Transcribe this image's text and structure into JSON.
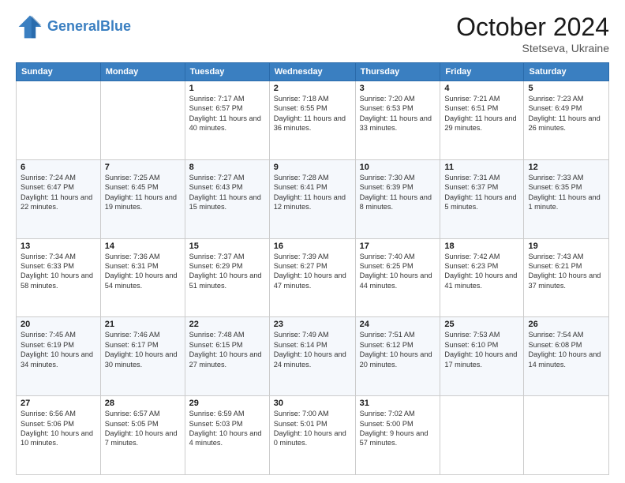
{
  "header": {
    "logo_line1": "General",
    "logo_line2": "Blue",
    "month": "October 2024",
    "location": "Stetseva, Ukraine"
  },
  "weekdays": [
    "Sunday",
    "Monday",
    "Tuesday",
    "Wednesday",
    "Thursday",
    "Friday",
    "Saturday"
  ],
  "weeks": [
    [
      {
        "day": "",
        "info": ""
      },
      {
        "day": "",
        "info": ""
      },
      {
        "day": "1",
        "info": "Sunrise: 7:17 AM\nSunset: 6:57 PM\nDaylight: 11 hours and 40 minutes."
      },
      {
        "day": "2",
        "info": "Sunrise: 7:18 AM\nSunset: 6:55 PM\nDaylight: 11 hours and 36 minutes."
      },
      {
        "day": "3",
        "info": "Sunrise: 7:20 AM\nSunset: 6:53 PM\nDaylight: 11 hours and 33 minutes."
      },
      {
        "day": "4",
        "info": "Sunrise: 7:21 AM\nSunset: 6:51 PM\nDaylight: 11 hours and 29 minutes."
      },
      {
        "day": "5",
        "info": "Sunrise: 7:23 AM\nSunset: 6:49 PM\nDaylight: 11 hours and 26 minutes."
      }
    ],
    [
      {
        "day": "6",
        "info": "Sunrise: 7:24 AM\nSunset: 6:47 PM\nDaylight: 11 hours and 22 minutes."
      },
      {
        "day": "7",
        "info": "Sunrise: 7:25 AM\nSunset: 6:45 PM\nDaylight: 11 hours and 19 minutes."
      },
      {
        "day": "8",
        "info": "Sunrise: 7:27 AM\nSunset: 6:43 PM\nDaylight: 11 hours and 15 minutes."
      },
      {
        "day": "9",
        "info": "Sunrise: 7:28 AM\nSunset: 6:41 PM\nDaylight: 11 hours and 12 minutes."
      },
      {
        "day": "10",
        "info": "Sunrise: 7:30 AM\nSunset: 6:39 PM\nDaylight: 11 hours and 8 minutes."
      },
      {
        "day": "11",
        "info": "Sunrise: 7:31 AM\nSunset: 6:37 PM\nDaylight: 11 hours and 5 minutes."
      },
      {
        "day": "12",
        "info": "Sunrise: 7:33 AM\nSunset: 6:35 PM\nDaylight: 11 hours and 1 minute."
      }
    ],
    [
      {
        "day": "13",
        "info": "Sunrise: 7:34 AM\nSunset: 6:33 PM\nDaylight: 10 hours and 58 minutes."
      },
      {
        "day": "14",
        "info": "Sunrise: 7:36 AM\nSunset: 6:31 PM\nDaylight: 10 hours and 54 minutes."
      },
      {
        "day": "15",
        "info": "Sunrise: 7:37 AM\nSunset: 6:29 PM\nDaylight: 10 hours and 51 minutes."
      },
      {
        "day": "16",
        "info": "Sunrise: 7:39 AM\nSunset: 6:27 PM\nDaylight: 10 hours and 47 minutes."
      },
      {
        "day": "17",
        "info": "Sunrise: 7:40 AM\nSunset: 6:25 PM\nDaylight: 10 hours and 44 minutes."
      },
      {
        "day": "18",
        "info": "Sunrise: 7:42 AM\nSunset: 6:23 PM\nDaylight: 10 hours and 41 minutes."
      },
      {
        "day": "19",
        "info": "Sunrise: 7:43 AM\nSunset: 6:21 PM\nDaylight: 10 hours and 37 minutes."
      }
    ],
    [
      {
        "day": "20",
        "info": "Sunrise: 7:45 AM\nSunset: 6:19 PM\nDaylight: 10 hours and 34 minutes."
      },
      {
        "day": "21",
        "info": "Sunrise: 7:46 AM\nSunset: 6:17 PM\nDaylight: 10 hours and 30 minutes."
      },
      {
        "day": "22",
        "info": "Sunrise: 7:48 AM\nSunset: 6:15 PM\nDaylight: 10 hours and 27 minutes."
      },
      {
        "day": "23",
        "info": "Sunrise: 7:49 AM\nSunset: 6:14 PM\nDaylight: 10 hours and 24 minutes."
      },
      {
        "day": "24",
        "info": "Sunrise: 7:51 AM\nSunset: 6:12 PM\nDaylight: 10 hours and 20 minutes."
      },
      {
        "day": "25",
        "info": "Sunrise: 7:53 AM\nSunset: 6:10 PM\nDaylight: 10 hours and 17 minutes."
      },
      {
        "day": "26",
        "info": "Sunrise: 7:54 AM\nSunset: 6:08 PM\nDaylight: 10 hours and 14 minutes."
      }
    ],
    [
      {
        "day": "27",
        "info": "Sunrise: 6:56 AM\nSunset: 5:06 PM\nDaylight: 10 hours and 10 minutes."
      },
      {
        "day": "28",
        "info": "Sunrise: 6:57 AM\nSunset: 5:05 PM\nDaylight: 10 hours and 7 minutes."
      },
      {
        "day": "29",
        "info": "Sunrise: 6:59 AM\nSunset: 5:03 PM\nDaylight: 10 hours and 4 minutes."
      },
      {
        "day": "30",
        "info": "Sunrise: 7:00 AM\nSunset: 5:01 PM\nDaylight: 10 hours and 0 minutes."
      },
      {
        "day": "31",
        "info": "Sunrise: 7:02 AM\nSunset: 5:00 PM\nDaylight: 9 hours and 57 minutes."
      },
      {
        "day": "",
        "info": ""
      },
      {
        "day": "",
        "info": ""
      }
    ]
  ]
}
